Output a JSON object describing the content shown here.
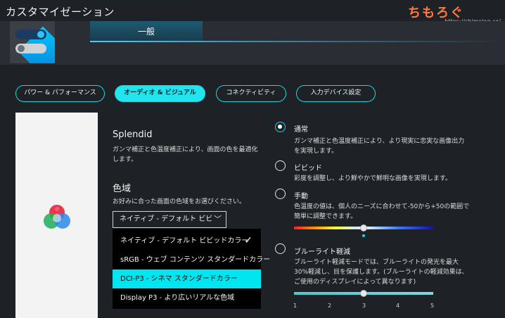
{
  "window": {
    "title": "カスタマイゼーション"
  },
  "watermark": {
    "title": "ちもろぐ",
    "url": "https://chimolog.co/"
  },
  "tabs": {
    "general": "一般"
  },
  "categories": [
    {
      "label": "パワー & パフォーマンス",
      "active": false
    },
    {
      "label": "オーディオ & ビジュアル",
      "active": true
    },
    {
      "label": "コネクティビティ",
      "active": false
    },
    {
      "label": "入力デバイス設定",
      "active": false
    }
  ],
  "splendid": {
    "title": "Splendid",
    "description": "ガンマ補正と色温度補正により、画面の色を最適化します。"
  },
  "gamut": {
    "title": "色域",
    "description": "お好みに合った画面の色域をお選びください。",
    "selected_value": "ネイティブ - デフォルト ビビッ",
    "options": [
      {
        "label": "ネイティブ - デフォルト ビビッドカラー",
        "checked": true,
        "highlighted": false
      },
      {
        "label": "sRGB - ウェブ コンテンツ スタンダードカラー",
        "checked": false,
        "highlighted": false
      },
      {
        "label": "DCI-P3 - シネマ スタンダードカラー",
        "checked": false,
        "highlighted": true
      },
      {
        "label": "Display P3 - より広いリアルな色域",
        "checked": false,
        "highlighted": false
      }
    ],
    "check_glyph": "✓"
  },
  "modes": {
    "normal": {
      "label": "通常",
      "selected": true,
      "description": "ガンマ補正と色温度補正により、より現実に忠実な画像出力を実現します。"
    },
    "vivid": {
      "label": "ビビッド",
      "selected": false,
      "description": "彩度を調整し、より鮮やかで鮮明な画像を実現します。"
    },
    "manual": {
      "label": "手動",
      "selected": false,
      "description": "色温度の値は、個人のニーズに合わせて-50から+50の範囲で簡単に調整できます。",
      "slider_value": 0,
      "slider_range": [
        -50,
        50
      ]
    },
    "bluelight": {
      "label": "ブルーライト軽減",
      "selected": false,
      "description": "ブルーライト軽減モードでは、ブルーライトの発光を最大30%軽減し、目を保護します。(ブルーライトの軽減効果は、ご使用のディスプレイによって異なります)",
      "slider_value": 3,
      "ticks": [
        "1",
        "2",
        "3",
        "4",
        "5"
      ]
    }
  },
  "colors": {
    "accent": "#22e4ee",
    "background": "#1e2126",
    "dropdown_highlight": "#00e6f0"
  }
}
